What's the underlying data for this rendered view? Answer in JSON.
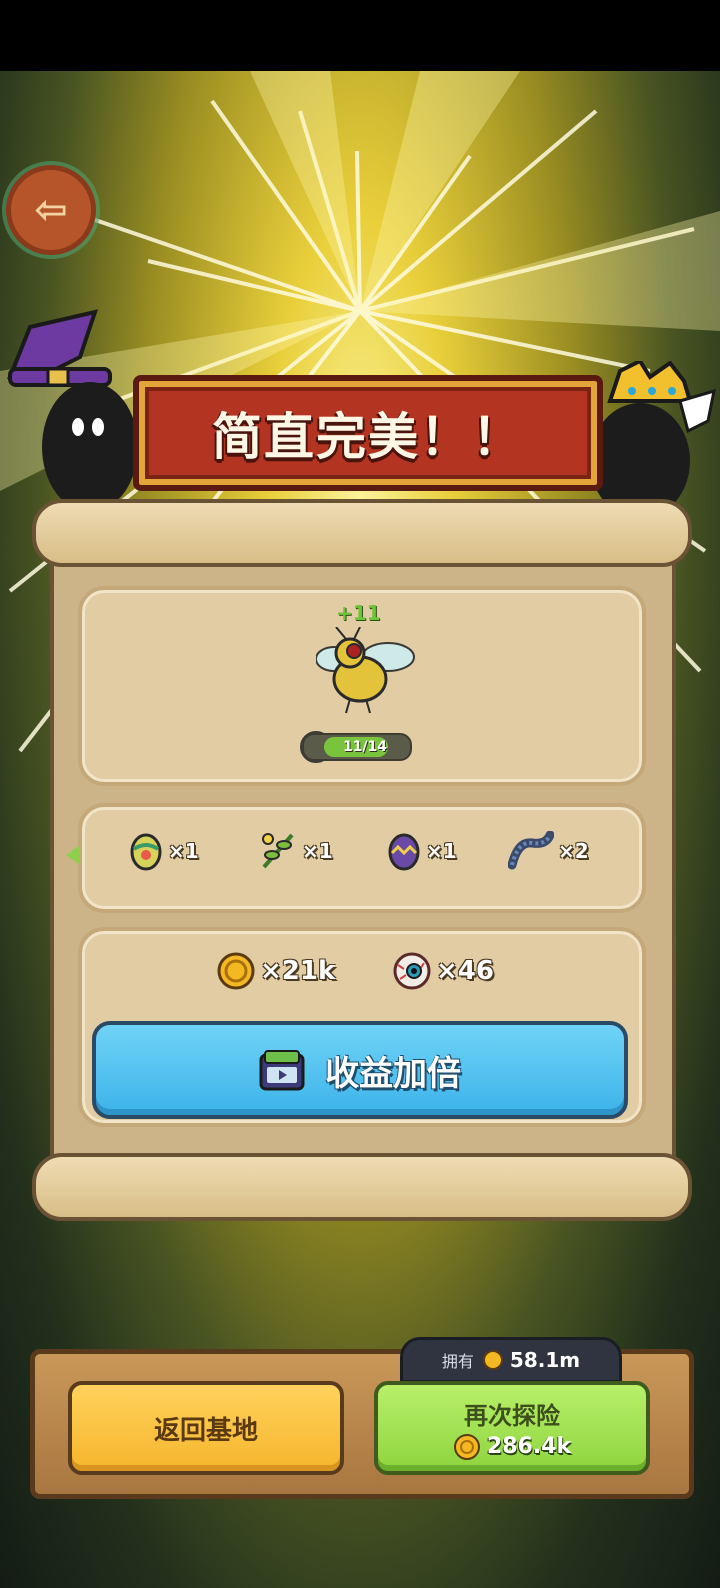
{
  "banner": {
    "title": "简直完美！！"
  },
  "creature": {
    "level_gain": "+11",
    "progress_text": "11/14",
    "progress": 0.786
  },
  "items": [
    {
      "icon": "egg-icon",
      "qty": "×1"
    },
    {
      "icon": "plant-sprout-icon",
      "qty": "×1"
    },
    {
      "icon": "purple-egg-icon",
      "qty": "×1"
    },
    {
      "icon": "worm-icon",
      "qty": "×2"
    }
  ],
  "rewards": [
    {
      "icon": "coin-icon",
      "qty": "×21k"
    },
    {
      "icon": "eyeball-icon",
      "qty": "×46"
    }
  ],
  "double_button": {
    "label": "收益加倍",
    "icon": "tv-ad-icon"
  },
  "owned": {
    "label": "拥有",
    "value": "58.1m"
  },
  "home_button": {
    "label": "返回基地"
  },
  "again_button": {
    "label": "再次探险",
    "cost": "286.4k"
  },
  "colors": {
    "banner": "#b43422",
    "double": "#4cc0ee",
    "again": "#9edf4c",
    "home": "#fcc446"
  }
}
